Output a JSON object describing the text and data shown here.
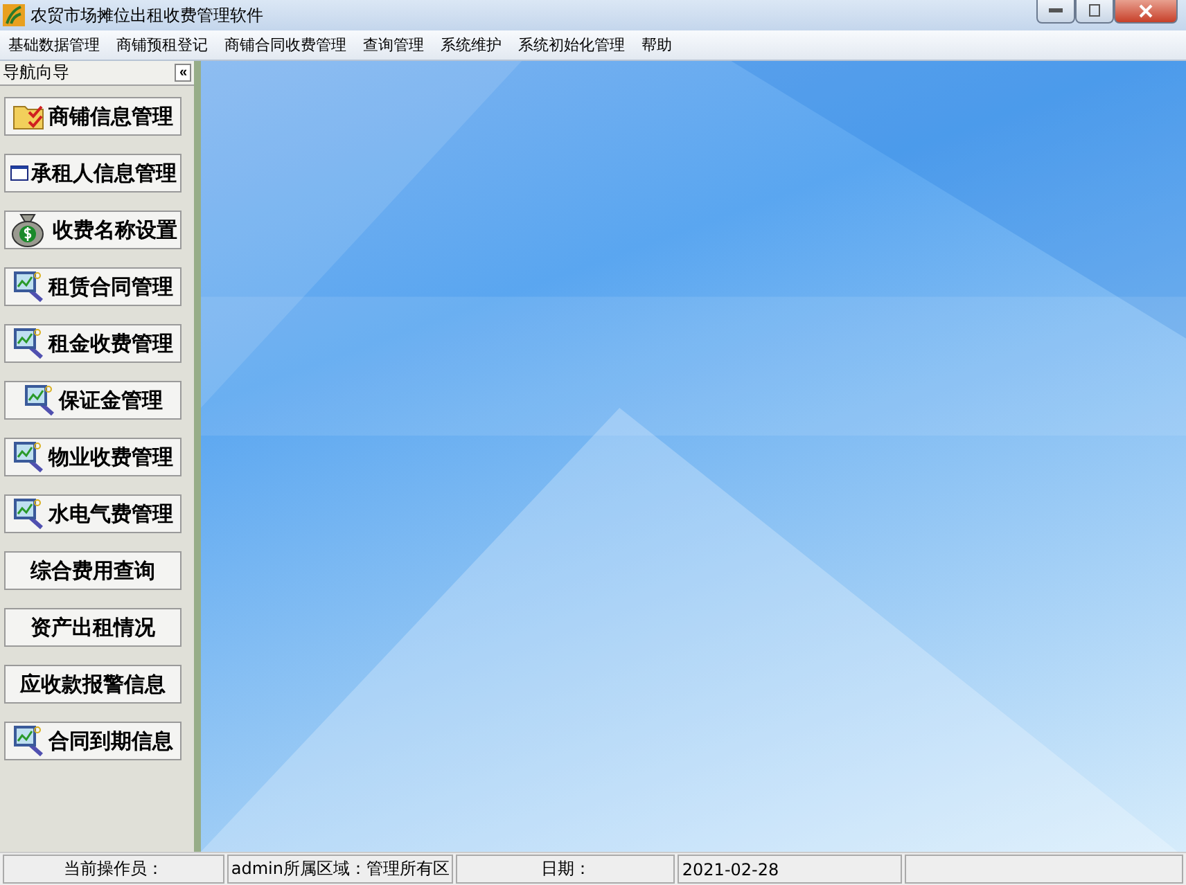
{
  "window": {
    "title": "农贸市场摊位出租收费管理软件"
  },
  "menu": [
    "基础数据管理",
    "商铺预租登记",
    "商铺合同收费管理",
    "查询管理",
    "系统维护",
    "系统初始化管理",
    "帮助"
  ],
  "sidebar": {
    "title": "导航向导",
    "collapse": "«",
    "items": [
      {
        "label": "商铺信息管理",
        "kind": "folder"
      },
      {
        "label": "承租人信息管理",
        "kind": "window"
      },
      {
        "label": "收费名称设置",
        "kind": "money"
      },
      {
        "label": "租赁合同管理",
        "kind": "chart"
      },
      {
        "label": "租金收费管理",
        "kind": "chart"
      },
      {
        "label": "保证金管理",
        "kind": "chart"
      },
      {
        "label": "物业收费管理",
        "kind": "chart"
      },
      {
        "label": "水电气费管理",
        "kind": "chart"
      },
      {
        "label": "综合费用查询",
        "kind": "plain"
      },
      {
        "label": "资产出租情况",
        "kind": "plain"
      },
      {
        "label": "应收款报警信息",
        "kind": "plain"
      },
      {
        "label": "合同到期信息",
        "kind": "chart"
      }
    ]
  },
  "status_bar": [
    "当前操作员：",
    "admin所属区域：管理所有区",
    "日期：",
    "2021-02-28"
  ]
}
